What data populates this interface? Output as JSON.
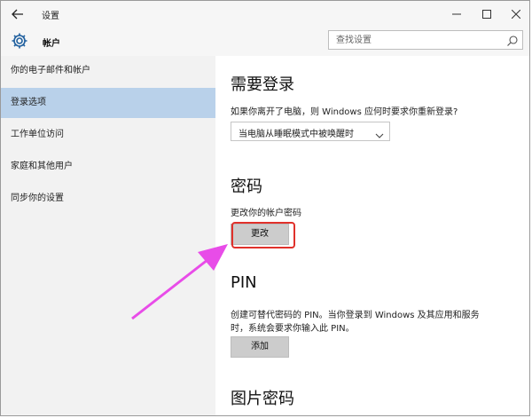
{
  "window": {
    "title": "设置",
    "back_icon": "arrow-left-icon",
    "controls": [
      "minimize-icon",
      "maximize-icon",
      "close-icon"
    ]
  },
  "header": {
    "icon": "gear-icon",
    "title": "帐户",
    "search_placeholder": "查找设置",
    "search_icon": "search-icon"
  },
  "sidebar": {
    "items": [
      {
        "label": "你的电子邮件和帐户",
        "active": false
      },
      {
        "label": "登录选项",
        "active": true
      },
      {
        "label": "工作单位访问",
        "active": false
      },
      {
        "label": "家庭和其他用户",
        "active": false
      },
      {
        "label": "同步你的设置",
        "active": false
      }
    ],
    "active_color": "#b9d1ea"
  },
  "main": {
    "require_signin": {
      "heading": "需要登录",
      "question": "如果你离开了电脑，则 Windows 应何时要求你重新登录?",
      "dropdown_value": "当电脑从睡眠模式中被唤醒时"
    },
    "password": {
      "heading": "密码",
      "description": "更改你的帐户密码",
      "button": "更改"
    },
    "pin": {
      "heading": "PIN",
      "description_line1": "创建可替代密码的 PIN。当你登录到 Windows 及其应用和服务",
      "description_line2": "时，系统会要求你输入此 PIN。",
      "button": "添加"
    },
    "picture_password": {
      "heading": "图片密码"
    }
  },
  "annotation": {
    "arrow_color": "#e84ce8",
    "highlight_color": "#e0312b"
  }
}
